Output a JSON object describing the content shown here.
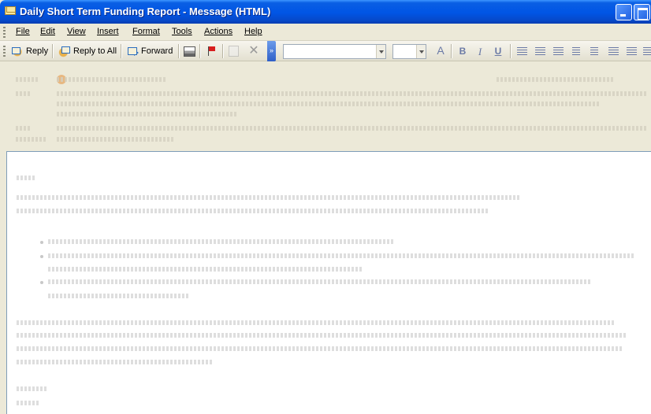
{
  "window": {
    "title": "Daily Short Term Funding Report - Message (HTML)"
  },
  "menu": [
    {
      "label": "File",
      "icon": "file-menu"
    },
    {
      "label": "Edit",
      "icon": "edit-menu"
    },
    {
      "label": "View",
      "icon": "view-menu"
    },
    {
      "label": "Insert",
      "icon": "insert-menu"
    },
    {
      "label": "Format",
      "icon": "format-menu"
    },
    {
      "label": "Tools",
      "icon": "tools-menu"
    },
    {
      "label": "Actions",
      "icon": "actions-menu"
    },
    {
      "label": "Help",
      "icon": "help-menu"
    }
  ],
  "toolbar": {
    "reply_label": "Reply",
    "reply_all_label": "Reply to All",
    "forward_label": "Forward",
    "icons": [
      "reply-icon",
      "reply-all-icon",
      "forward-icon",
      "print-icon",
      "flag-icon",
      "move-icon",
      "delete-icon",
      "bold-icon",
      "italic-icon",
      "underline-icon",
      "align-left-icon",
      "center-icon",
      "align-right-icon",
      "bullets-icon",
      "numbering-icon",
      "decrease-indent-icon",
      "increase-indent-icon"
    ],
    "format": {
      "bold": "B",
      "italic": "I",
      "underline": "U",
      "font_color": "A"
    }
  },
  "header": {
    "from_label": "From:",
    "to_label": "To:",
    "cc_label": "Cc:",
    "subject_label": "Subject:"
  },
  "colors": {
    "titlebar": "#0055E5",
    "chrome": "#ECE9D8",
    "body_bg": "#FFFFFF",
    "flag": "#D81E1E"
  }
}
